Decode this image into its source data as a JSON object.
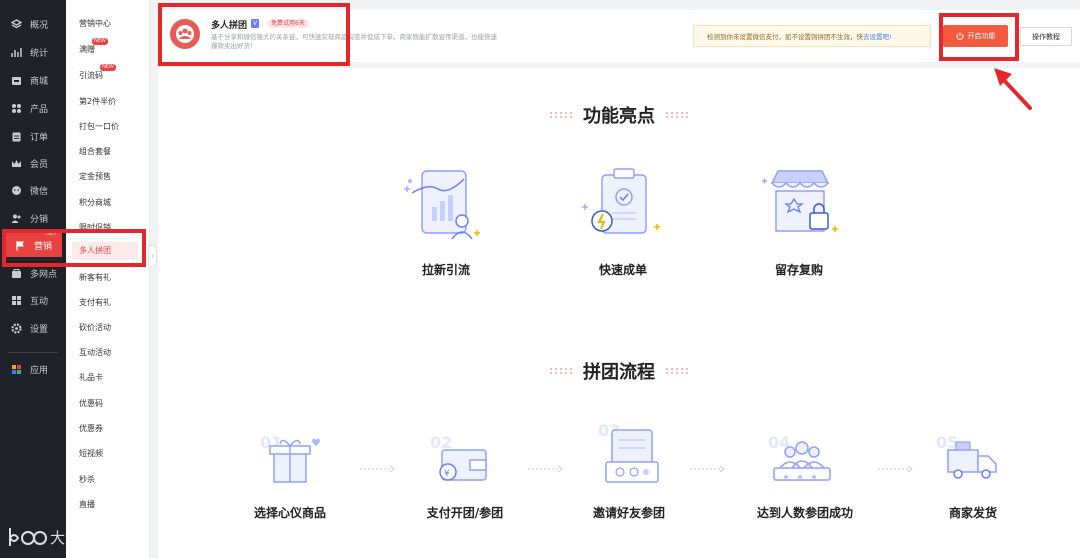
{
  "sidebar": {
    "items": [
      {
        "label": "概况",
        "icon": "overview-icon"
      },
      {
        "label": "统计",
        "icon": "chart-icon"
      },
      {
        "label": "商城",
        "icon": "store-icon"
      },
      {
        "label": "产品",
        "icon": "grid-icon"
      },
      {
        "label": "订单",
        "icon": "order-icon"
      },
      {
        "label": "会员",
        "icon": "crown-icon"
      },
      {
        "label": "微信",
        "icon": "wechat-icon"
      },
      {
        "label": "分销",
        "icon": "users-icon"
      },
      {
        "label": "营销",
        "icon": "flag-icon",
        "badge": "HOT"
      },
      {
        "label": "多网点",
        "icon": "branch-icon"
      },
      {
        "label": "互动",
        "icon": "apps-icon"
      },
      {
        "label": "设置",
        "icon": "gear-icon"
      },
      {
        "label": "应用",
        "icon": "colorful-apps-icon"
      }
    ]
  },
  "subnav": {
    "items": [
      {
        "label": "营销中心"
      },
      {
        "label": "满赠",
        "badge": "NEW"
      },
      {
        "label": "引流码",
        "badge": "NEW"
      },
      {
        "label": "第2件半价"
      },
      {
        "label": "打包一口价"
      },
      {
        "label": "组合套餐"
      },
      {
        "label": "定金预售"
      },
      {
        "label": "积分商城"
      },
      {
        "label": "限时促销"
      },
      {
        "label": "多人拼团"
      },
      {
        "label": "新客有礼"
      },
      {
        "label": "支付有礼"
      },
      {
        "label": "砍价活动"
      },
      {
        "label": "互动活动"
      },
      {
        "label": "礼品卡"
      },
      {
        "label": "优惠码"
      },
      {
        "label": "优惠券"
      },
      {
        "label": "短视频"
      },
      {
        "label": "秒杀"
      },
      {
        "label": "直播"
      }
    ]
  },
  "header": {
    "title": "多人拼团",
    "version_tag": "V",
    "trial_tag": "免费试用6天",
    "description": "基于分享和微信强大的关系链，可快速实现商品裂变并促成下单，商家既能扩散宣传渠道，也能快速爆款卖出好货!",
    "notice_text": "检测到你未设置微信支付，如不设置则拼团不生效，快",
    "notice_link": "去设置吧!",
    "open_button": "开启功能",
    "guide_button": "操作教程"
  },
  "highlights": {
    "title": "功能亮点",
    "items": [
      {
        "label": "拉新引流",
        "icon": "growth-icon"
      },
      {
        "label": "快速成单",
        "icon": "fast-order-icon"
      },
      {
        "label": "留存复购",
        "icon": "retention-icon"
      }
    ]
  },
  "process": {
    "title": "拼团流程",
    "steps": [
      {
        "num": "01",
        "label": "选择心仪商品",
        "icon": "gift-icon"
      },
      {
        "num": "02",
        "label": "支付开团/参团",
        "icon": "wallet-icon"
      },
      {
        "num": "03",
        "label": "邀请好友参团",
        "icon": "invite-icon"
      },
      {
        "num": "04",
        "label": "达到人数参团成功",
        "icon": "group-icon"
      },
      {
        "num": "05",
        "label": "商家发货",
        "icon": "truck-icon"
      }
    ]
  },
  "watermark": "大数跨境",
  "colors": {
    "accent": "#f25b3e",
    "highlight": "#e3282d",
    "sidebar": "#1f2229"
  }
}
